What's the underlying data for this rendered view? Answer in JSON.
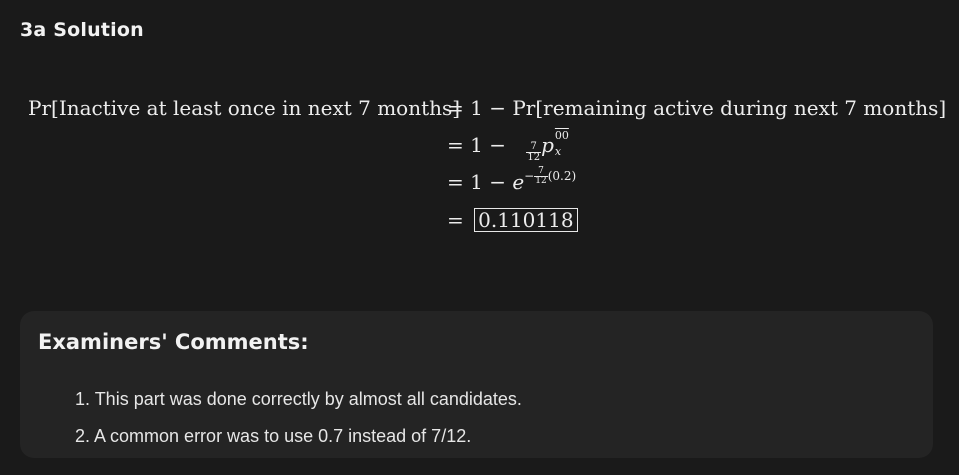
{
  "heading": "3a Solution",
  "equation": {
    "lhs": "Pr[Inactive at least once in next 7 months]",
    "line1_rhs": "= 1 − Pr[remaining active during next 7 months]",
    "line2": {
      "prefix": "= 1 −",
      "frac_num": "7",
      "frac_den": "12",
      "p": "p",
      "sup": "00",
      "sub": "x"
    },
    "line3": {
      "prefix": "= 1 −",
      "e": "e",
      "exp_sign": "−",
      "exp_frac_num": "7",
      "exp_frac_den": "12",
      "exp_tail": "(0.2)"
    },
    "line4": {
      "prefix": "=",
      "answer": "0.110118"
    }
  },
  "examiners": {
    "title": "Examiners' Comments:",
    "items": [
      {
        "label": "1. This part was done correctly by almost all candidates."
      },
      {
        "label": "2. A common error was to use 0.7 instead of 7/12."
      }
    ]
  }
}
